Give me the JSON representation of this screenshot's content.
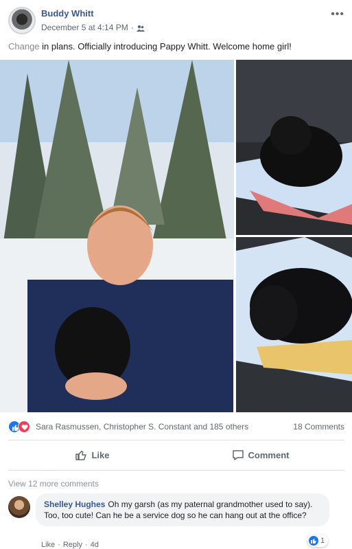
{
  "post": {
    "author": "Buddy Whitt",
    "timestamp": "December 5 at 4:14 PM",
    "separator": "·",
    "audience_icon": "friends-icon",
    "more_label": "•••",
    "text_first_word": "Change",
    "text_rest": " in plans. Officially introducing Pappy Whitt. Welcome home girl!"
  },
  "photos": [
    {
      "name": "photo-main",
      "icon": "photo"
    },
    {
      "name": "photo-top",
      "icon": "photo"
    },
    {
      "name": "photo-bottom",
      "icon": "photo"
    }
  ],
  "reactions": {
    "icons": [
      "like-reaction-icon",
      "love-reaction-icon"
    ],
    "reactors": "Sara Rasmussen, Christopher S. Constant and 185 others",
    "comments": "18 Comments"
  },
  "actions": {
    "like_label": "Like",
    "comment_label": "Comment"
  },
  "comments_section": {
    "view_more": "View 12 more comments",
    "comment": {
      "author": "Shelley Hughes",
      "text": "Oh my garsh (as my paternal grandmother used to say). Too, too cute! Can he be a service dog so he can hang out at the office?",
      "reaction_count": "1",
      "like_label": "Like",
      "reply_label": "Reply",
      "dot": "·",
      "age": "4d"
    }
  },
  "colors": {
    "link_blue": "#385898",
    "facebook_blue": "#1877f2",
    "love_red": "#f33e58",
    "secondary_text": "#606770"
  }
}
